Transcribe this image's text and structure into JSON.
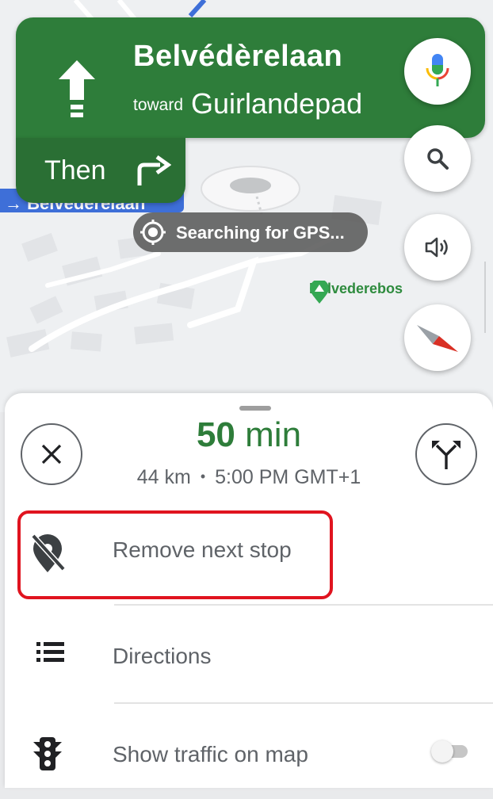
{
  "navigation": {
    "street": "Belvédèrelaan",
    "toward_label": "toward",
    "toward_street": "Guirlandepad",
    "then_label": "Then",
    "current_street_tag": "Belvederelaan"
  },
  "map": {
    "gps_status": "Searching for GPS...",
    "poi_label": "Belvederebos"
  },
  "controls": {
    "mic": "mic-icon",
    "search": "search-icon",
    "sound": "sound-icon",
    "compass": "compass-icon"
  },
  "trip": {
    "eta_number": "50",
    "eta_unit": "min",
    "distance": "44 km",
    "separator": "•",
    "arrival": "5:00 PM GMT+1"
  },
  "menu": {
    "items": [
      {
        "label": "Remove next stop",
        "icon": "pin-off-icon"
      },
      {
        "label": "Directions",
        "icon": "list-icon"
      },
      {
        "label": "Show traffic on map",
        "icon": "traffic-light-icon",
        "toggle_on": false
      }
    ]
  },
  "colors": {
    "nav_green": "#2e7d3a",
    "highlight_red": "#e0141f",
    "eta_green": "#2e7d3a"
  }
}
